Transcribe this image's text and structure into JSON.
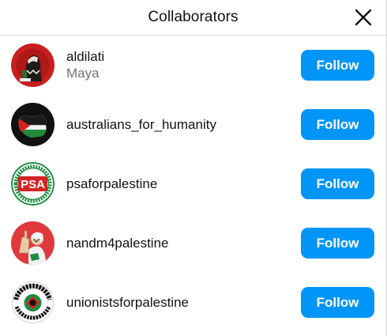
{
  "dialog": {
    "title": "Collaborators",
    "close_icon": "close-icon"
  },
  "colors": {
    "follow_button": "#0095f6",
    "follow_text": "#ffffff",
    "secondary_text": "#737373"
  },
  "collaborators": [
    {
      "username": "aldilati",
      "full_name": "Maya",
      "button": "Follow",
      "avatar": "keffiyeh-portrait-avatar"
    },
    {
      "username": "australians_for_humanity",
      "full_name": "",
      "button": "Follow",
      "avatar": "palestine-flag-map-avatar"
    },
    {
      "username": "psaforpalestine",
      "full_name": "",
      "button": "Follow",
      "avatar": "psa-logo-avatar",
      "avatar_text": "PSA"
    },
    {
      "username": "nandm4palestine",
      "full_name": "",
      "button": "Follow",
      "avatar": "raised-fist-illustration-avatar"
    },
    {
      "username": "unionistsforpalestine",
      "full_name": "",
      "button": "Follow",
      "avatar": "unionists-logo-avatar"
    }
  ]
}
